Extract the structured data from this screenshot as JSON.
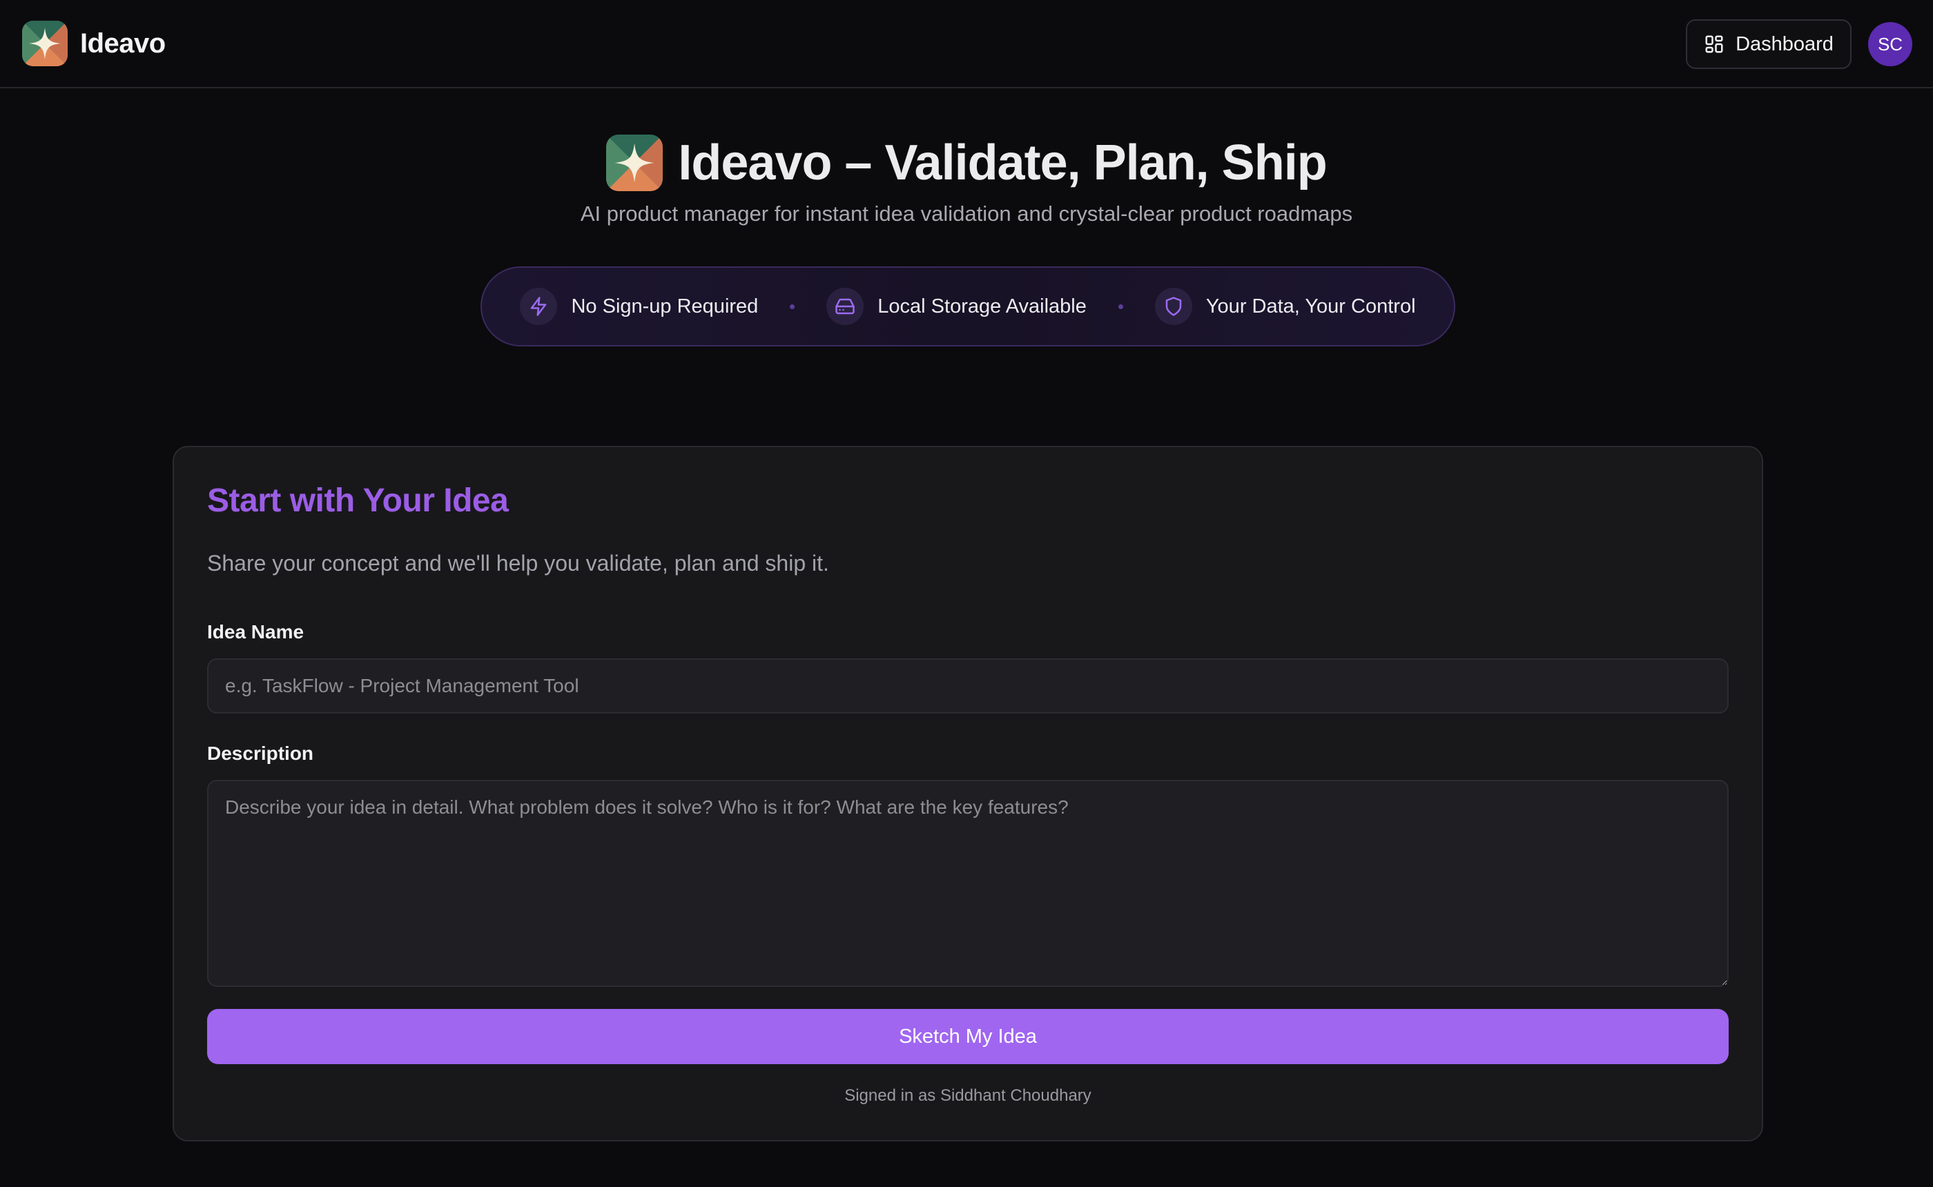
{
  "app": {
    "name": "Ideavo"
  },
  "header": {
    "dashboard_label": "Dashboard",
    "avatar_initials": "SC"
  },
  "hero": {
    "title": "Ideavo – Validate, Plan, Ship",
    "subtitle": "AI product manager for instant idea validation and crystal-clear product roadmaps",
    "features": [
      {
        "label": "No Sign-up Required",
        "icon": "lightning-icon"
      },
      {
        "label": "Local Storage Available",
        "icon": "hard-drive-icon"
      },
      {
        "label": "Your Data, Your Control",
        "icon": "shield-icon"
      }
    ]
  },
  "form": {
    "title": "Start with Your Idea",
    "description": "Share your concept and we'll help you validate, plan and ship it.",
    "idea_name": {
      "label": "Idea Name",
      "value": "",
      "placeholder": "e.g. TaskFlow - Project Management Tool"
    },
    "idea_description": {
      "label": "Description",
      "value": "",
      "placeholder": "Describe your idea in detail. What problem does it solve? Who is it for? What are the key features?"
    },
    "submit_label": "Sketch My Idea",
    "signed_in_text": "Signed in as Siddhant Choudhary"
  },
  "colors": {
    "background": "#0b0b0d",
    "card": "#18181b",
    "accent": "#a066f0",
    "accent_text": "#9b5de5",
    "avatar": "#5b2bb0"
  }
}
